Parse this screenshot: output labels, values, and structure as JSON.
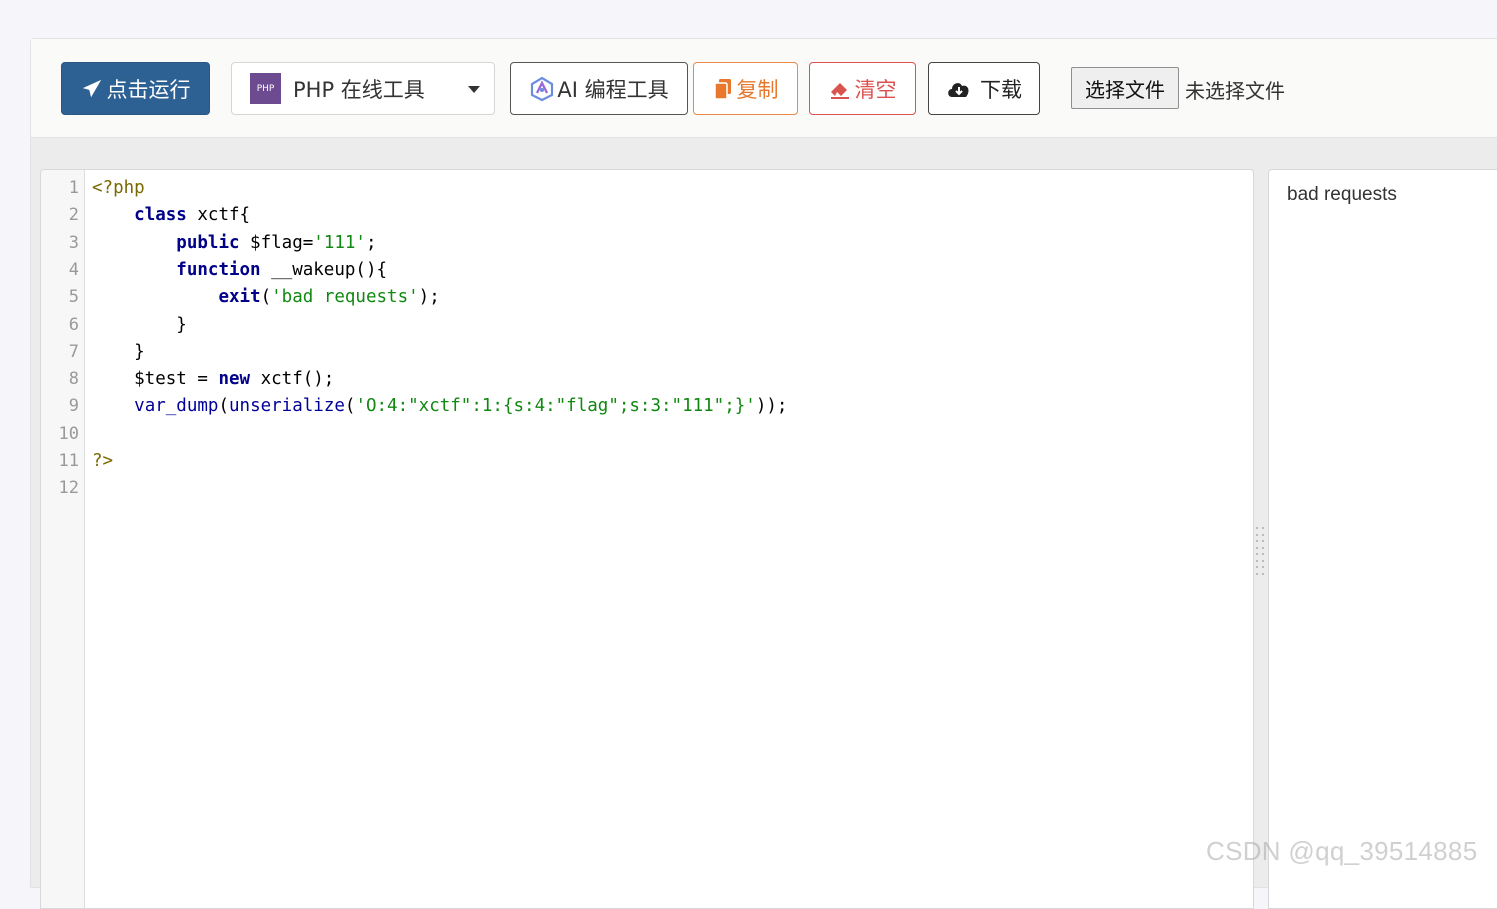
{
  "toolbar": {
    "run_label": "点击运行",
    "language_selected": "PHP 在线工具",
    "language_logo": "PHP",
    "ai_label": "AI 编程工具",
    "copy_label": "复制",
    "clear_label": "清空",
    "download_label": "下载",
    "choose_file_label": "选择文件",
    "file_status": "未选择文件"
  },
  "icons": {
    "run": "paper-plane-icon",
    "ai": "ai-logo-icon",
    "copy": "copy-icon",
    "clear": "eraser-icon",
    "download": "cloud-download-icon",
    "dropdown": "caret-down-icon"
  },
  "colors": {
    "run_button": "#2e6193",
    "copy_button": "#e7782d",
    "clear_button": "#d9534f",
    "php_logo": "#6c4b90"
  },
  "editor": {
    "line_numbers": [
      "1",
      "2",
      "3",
      "4",
      "5",
      "6",
      "7",
      "8",
      "9",
      "10",
      "11",
      "12"
    ],
    "lines": [
      [
        {
          "t": "<?php",
          "c": "tag"
        }
      ],
      [
        {
          "t": "    ",
          "c": "plain"
        },
        {
          "t": "class",
          "c": "kw"
        },
        {
          "t": " xctf{",
          "c": "plain"
        }
      ],
      [
        {
          "t": "        ",
          "c": "plain"
        },
        {
          "t": "public",
          "c": "kw"
        },
        {
          "t": " $flag=",
          "c": "plain"
        },
        {
          "t": "'111'",
          "c": "str"
        },
        {
          "t": ";",
          "c": "plain"
        }
      ],
      [
        {
          "t": "        ",
          "c": "plain"
        },
        {
          "t": "function",
          "c": "kw"
        },
        {
          "t": " __wakeup(){",
          "c": "plain"
        }
      ],
      [
        {
          "t": "            ",
          "c": "plain"
        },
        {
          "t": "exit",
          "c": "kw"
        },
        {
          "t": "(",
          "c": "plain"
        },
        {
          "t": "'bad requests'",
          "c": "str"
        },
        {
          "t": ");",
          "c": "plain"
        }
      ],
      [
        {
          "t": "        }",
          "c": "plain"
        }
      ],
      [
        {
          "t": "    }",
          "c": "plain"
        }
      ],
      [
        {
          "t": "    $test = ",
          "c": "plain"
        },
        {
          "t": "new",
          "c": "kw"
        },
        {
          "t": " xctf();",
          "c": "plain"
        }
      ],
      [
        {
          "t": "    ",
          "c": "plain"
        },
        {
          "t": "var_dump",
          "c": "fn"
        },
        {
          "t": "(",
          "c": "plain"
        },
        {
          "t": "unserialize",
          "c": "fn"
        },
        {
          "t": "(",
          "c": "plain"
        },
        {
          "t": "'O:4:\"xctf\":1:{s:4:\"flag\";s:3:\"111\";}'",
          "c": "str"
        },
        {
          "t": "));",
          "c": "plain"
        }
      ],
      [],
      [
        {
          "t": "?>",
          "c": "tag"
        }
      ],
      []
    ]
  },
  "output": {
    "text": "bad requests"
  },
  "watermark": "CSDN @qq_39514885"
}
